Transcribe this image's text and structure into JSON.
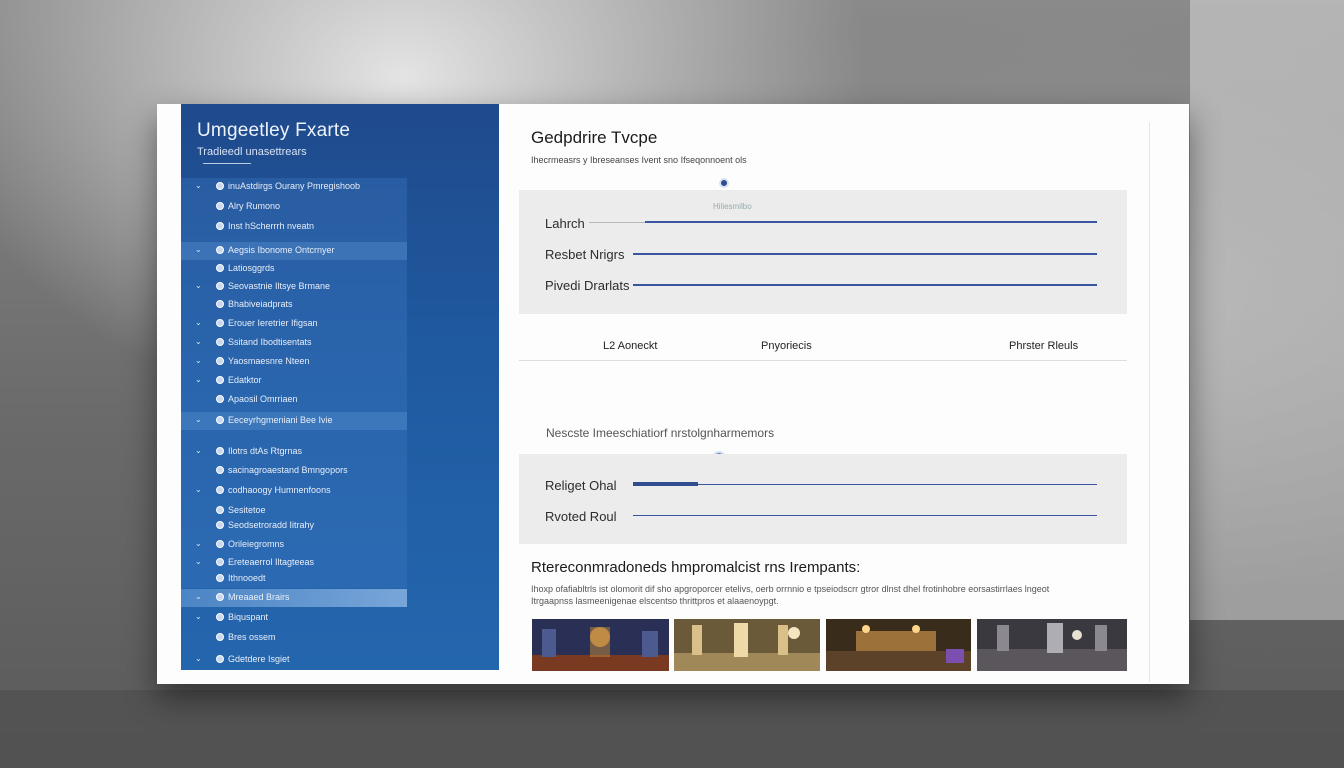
{
  "sidebar": {
    "title": "Umgeetley Fxarte",
    "subtitle": "Tradieedl unasettrears",
    "items": [
      {
        "label": "inuAstdirgs Ourany Pmregishoob",
        "chevron": true
      },
      {
        "label": "Alry Rumono",
        "chevron": false
      },
      {
        "label": "Inst hScherrrh nveatn",
        "chevron": false
      },
      {
        "label": "Aegsis Ibonome Ontcrnyer",
        "chevron": true
      },
      {
        "label": "Latiosggrds",
        "chevron": false
      },
      {
        "label": "Seovastnie Iltsye Brmane",
        "chevron": true
      },
      {
        "label": "Bhabiveiadprats",
        "chevron": false
      },
      {
        "label": "Erouer Ieretrier Ifigsan",
        "chevron": true
      },
      {
        "label": "Ssitand Ibodtisentats",
        "chevron": true
      },
      {
        "label": "Yaosmaesnre Nteen",
        "chevron": true
      },
      {
        "label": "Edatktor",
        "chevron": true
      },
      {
        "label": "Apaosil Omrriaen",
        "chevron": false
      },
      {
        "label": "Eeceyrhgmeniani Bee Ivie",
        "chevron": true
      },
      {
        "label": "Ilotrs dtAs Rtgrnas",
        "chevron": true
      },
      {
        "label": "sacinagroaestand Bmngopors",
        "chevron": false
      },
      {
        "label": "codhaoogy Humnenfoons",
        "chevron": true
      },
      {
        "label": "Sesitetoe",
        "chevron": false
      },
      {
        "label": "Seodsetroradd Iitrahy",
        "chevron": false
      },
      {
        "label": "Orileiegromns",
        "chevron": true
      },
      {
        "label": "Ereteaerrol Iltagteeas",
        "chevron": true
      },
      {
        "label": "Ithnooedt",
        "chevron": false
      },
      {
        "label": "Mreaaed Brairs",
        "chevron": true
      },
      {
        "label": "Biquspant",
        "chevron": true
      },
      {
        "label": "Bres ossem",
        "chevron": false
      },
      {
        "label": "Gdetdere Isgiet",
        "chevron": true
      }
    ]
  },
  "main": {
    "title": "Gedpdrire Tvcpe",
    "description": "Ihecrmeasrs y Ibreseanses Ivent sno Ifseqonnoent ols",
    "card1": {
      "caption": "Hiliesmilbo",
      "rows": [
        "Lahrch",
        "Resbet Nrigrs",
        "Pivedi Drarlats"
      ]
    },
    "tabs": [
      "L2 Aoneckt",
      "Pnyoriecis",
      "Phrster Rleuls"
    ],
    "section_heading": "Nescste Imeeschiatiorf nrstolgnharmemors",
    "card2": {
      "rows": [
        "Religet Ohal",
        "Rvoted Roul"
      ],
      "progress": 0.14
    },
    "recommendations": {
      "title": "Rtereconmradoneds hmpromalcist rns Irempants:",
      "description": "Ihoxp ofafiabltrls ist olomorit dif sho apgroporcer etelivs, oerb orrnnio e tpseiodscrr gtror dlnst dhel frotinhobre eorsastirrlaes lngeot Itrgaapnss lasmeenigenae elscentso thrittpros et alaaenoypgt."
    }
  },
  "colors": {
    "sidebar_top": "#1f4a8c",
    "sidebar_bottom": "#2466ae",
    "accent": "#3a56a0",
    "card_bg": "#ececec"
  }
}
